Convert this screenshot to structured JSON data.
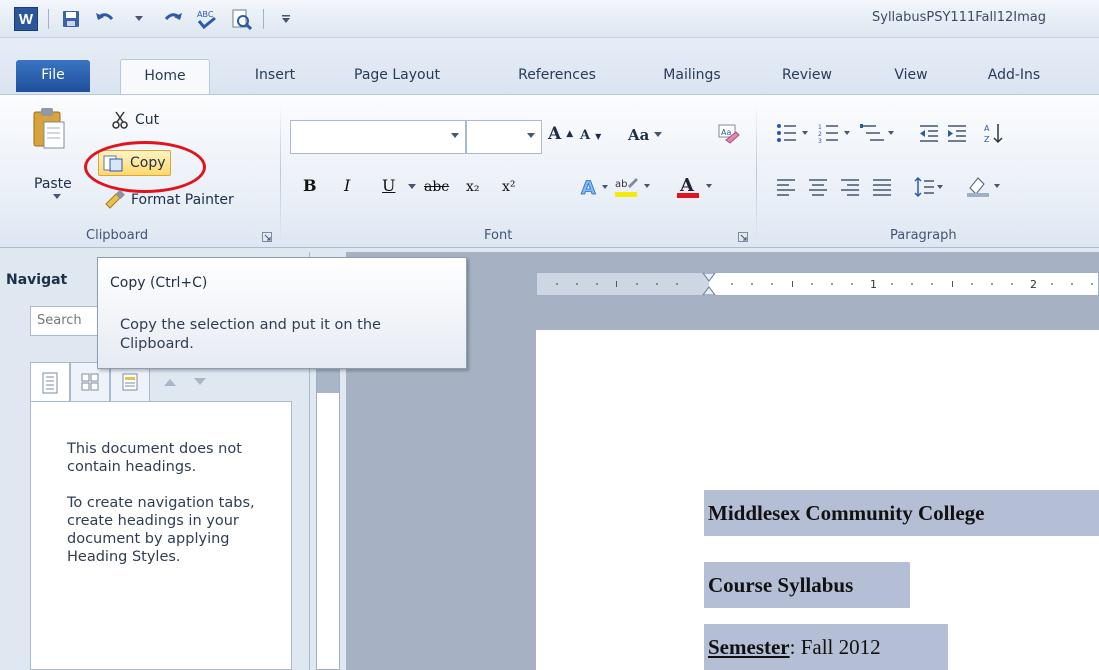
{
  "window": {
    "title": "SyllabusPSY111Fall12Imag"
  },
  "quick_access": {
    "icons": [
      "word-icon",
      "save-icon",
      "undo-icon",
      "redo-icon",
      "spelling-icon",
      "print-preview-icon",
      "customize-icon"
    ]
  },
  "tabs": [
    {
      "label": "File"
    },
    {
      "label": "Home"
    },
    {
      "label": "Insert"
    },
    {
      "label": "Page Layout"
    },
    {
      "label": "References"
    },
    {
      "label": "Mailings"
    },
    {
      "label": "Review"
    },
    {
      "label": "View"
    },
    {
      "label": "Add-Ins"
    }
  ],
  "clipboard": {
    "paste": "Paste",
    "cut": "Cut",
    "copy": "Copy",
    "format_painter": "Format Painter",
    "group_label": "Clipboard"
  },
  "font": {
    "group_label": "Font",
    "font_name": "",
    "font_size": "",
    "change_case": "Aa",
    "bold": "B",
    "italic": "I",
    "underline": "U",
    "strikethrough": "abc",
    "subscript": "x₂",
    "superscript": "x²"
  },
  "paragraph": {
    "group_label": "Paragraph"
  },
  "navigation": {
    "title": "Navigat",
    "search_placeholder": "Search",
    "message_1": "This document does not contain headings.",
    "message_2": "To create navigation tabs, create headings in your document by applying Heading Styles."
  },
  "tooltip": {
    "title": "Copy (Ctrl+C)",
    "description": "Copy the selection and put it on the Clipboard."
  },
  "document": {
    "line_1": "Middlesex Community College",
    "line_2": "Course Syllabus",
    "line_3_label": "Semester",
    "line_3_value": ": Fall 2012"
  },
  "colors": {
    "selection": "#b4bfd5",
    "file_tab": "#2b5fad",
    "highlight_circle": "#e0141c"
  }
}
